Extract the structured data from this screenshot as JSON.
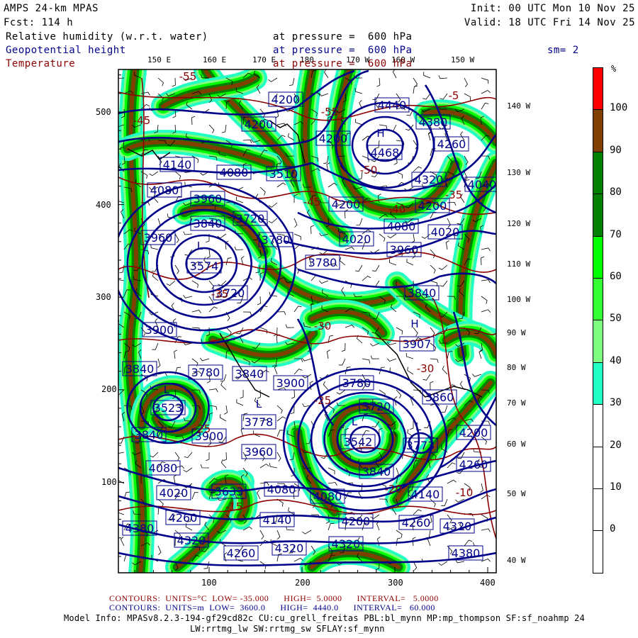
{
  "header": {
    "title": "AMPS 24-km MPAS",
    "fcst": "Fcst: 114 h",
    "init": "Init: 00 UTC Mon 10 Nov 25",
    "valid": "Valid: 18 UTC Fri 14 Nov 25",
    "field1": "Relative humidity (w.r.t. water)",
    "field1_level": "at pressure =  600 hPa",
    "field2": "Geopotential height",
    "field2_level": "at pressure =  600 hPa",
    "smoothing": "sm= 2",
    "field3": "Temperature",
    "field3_level": "at pressure =  600 hPa"
  },
  "colors": {
    "height": "#00008b",
    "temperature": "#8b0000"
  },
  "axes": {
    "bottom": [
      "100",
      "200",
      "300",
      "400"
    ],
    "left": [
      "500",
      "400",
      "300",
      "200",
      "100"
    ],
    "top_lon": [
      "150 E",
      "160 E",
      "170 E",
      "180",
      "170 W",
      "160 W",
      "150 W"
    ],
    "right_lon": [
      "140 W",
      "130 W",
      "120 W",
      "110 W",
      "100 W",
      "90 W",
      "80 W",
      "70 W",
      "60 W",
      "50 W",
      "40 W"
    ]
  },
  "colorbar": {
    "unit": "%",
    "labels": [
      "100",
      "90",
      "80",
      "70",
      "60",
      "50",
      "40",
      "30",
      "20",
      "10",
      "0"
    ],
    "colors": [
      "#ff0000",
      "#7f3f00",
      "#007f00",
      "#007f00",
      "#00ff00",
      "#33ff33",
      "#7fff7f",
      "#22ffc4",
      "#ffffff",
      "#ffffff",
      "#ffffff",
      "#ffffff"
    ]
  },
  "height_labels": [
    "4200",
    "4200",
    "4440",
    "4380",
    "4468",
    "4200",
    "4260",
    "4140",
    "4080",
    "3510",
    "4320",
    "4040",
    "4200",
    "4200",
    "4080",
    "3960",
    "4020",
    "4020",
    "4080",
    "3960",
    "3840",
    "3720",
    "3960",
    "3780",
    "3780",
    "3840",
    "3574",
    "3720",
    "3900",
    "3907",
    "3840",
    "3780",
    "3840",
    "3900",
    "3780",
    "3860",
    "3523",
    "3720",
    "3778",
    "3542",
    "3773",
    "4200",
    "3840",
    "3900",
    "3960",
    "4260",
    "3840",
    "4080",
    "4020",
    "3633",
    "4080",
    "4080",
    "4140",
    "4140",
    "4200",
    "4260",
    "4260",
    "4320",
    "4380",
    "4320",
    "4260",
    "4320",
    "4320",
    "4380"
  ],
  "centers": [
    "H",
    "L",
    "H",
    "L",
    "L",
    "L",
    "L"
  ],
  "temp_labels": [
    "-55",
    "-55",
    "-50",
    "-45",
    "-45",
    "-40",
    "-35",
    "-35",
    "-30",
    "-30",
    "-25",
    "-25",
    "-20",
    "-15",
    "-10",
    "-5"
  ],
  "footer": {
    "temp_contours": "CONTOURS:  UNITS=°C  LOW= -35.000      HIGH=  5.0000      INTERVAL=   5.0000",
    "height_contours": "CONTOURS:  UNITS=m  LOW=  3600.0      HIGH=  4440.0      INTERVAL=   60.000",
    "model_info": "Model Info: MPASv8.2.3-194-gf29cd82c CU:cu_grell_freitas PBL:bl_mynn MP:mp_thompson SF:sf_noahmp 24",
    "model_info2": "LW:rrtmg_lw SW:rrtmg_sw SFLAY:sf_mynn"
  }
}
